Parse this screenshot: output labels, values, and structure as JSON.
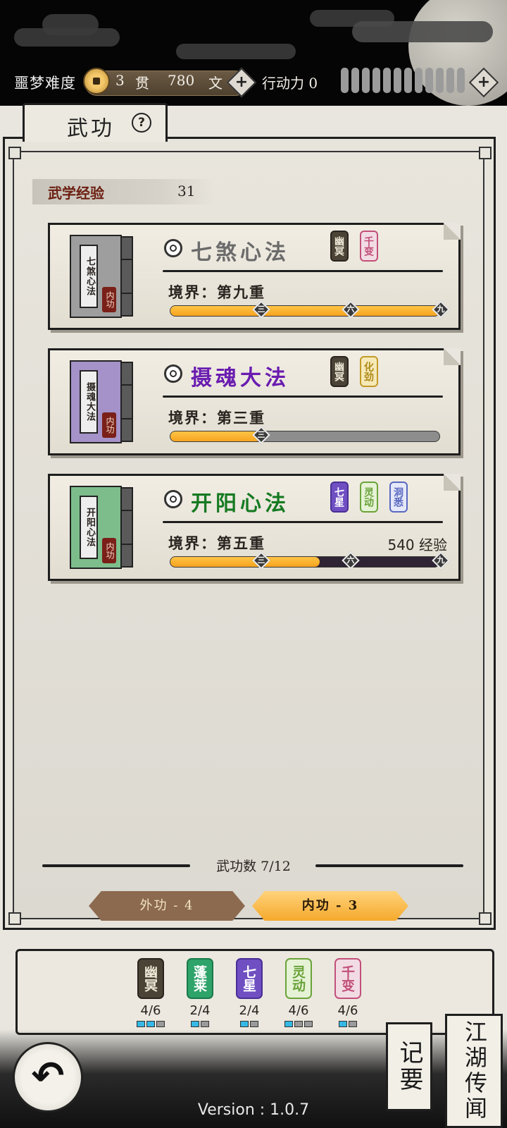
{
  "header": {
    "difficulty_label": "噩梦难度",
    "guan_amount": "3",
    "guan_unit": "贯",
    "wen_amount": "780",
    "wen_unit": "文",
    "action_label": "行动力",
    "action_value": "0",
    "action_pips_filled": 0,
    "action_pips_total": 12
  },
  "panel": {
    "tab_title": "武功",
    "help_symbol": "?",
    "exp_label": "武学经验",
    "exp_value": "31"
  },
  "skills": [
    {
      "name": "七煞心法",
      "name_color": "#6b6b6b",
      "book_color": "#9e9e9e",
      "book_title": "七煞心法",
      "book_seal": "内功",
      "tags": [
        {
          "text": "幽冥",
          "bg": "#4a4336",
          "fg": "#f0ead8",
          "border": "#2a2420"
        },
        {
          "text": "千变",
          "bg": "#f2dce4",
          "fg": "#c2507a",
          "border": "#c2507a"
        }
      ],
      "realm": "境界：第九重",
      "exp_text": "",
      "progress": 1.0,
      "markers": [
        "三",
        "六",
        "九"
      ]
    },
    {
      "name": "摄魂大法",
      "name_color": "#6a1cb0",
      "book_color": "#a592c8",
      "book_title": "摄魂大法",
      "book_seal": "内功",
      "tags": [
        {
          "text": "幽冥",
          "bg": "#4a4336",
          "fg": "#f0ead8",
          "border": "#2a2420"
        },
        {
          "text": "化劲",
          "bg": "#f5e9b8",
          "fg": "#b08a18",
          "border": "#c29a26"
        }
      ],
      "realm": "境界：第三重",
      "exp_text": "",
      "progress": 0.333,
      "markers": [
        "三"
      ]
    },
    {
      "name": "开阳心法",
      "name_color": "#167a22",
      "book_color": "#7dbd8c",
      "book_title": "开阳心法",
      "book_seal": "内功",
      "tags": [
        {
          "text": "七星",
          "bg": "#6f4fc2",
          "fg": "#ffffff",
          "border": "#4a2f96"
        },
        {
          "text": "灵动",
          "bg": "#e6f2d6",
          "fg": "#6aa33a",
          "border": "#6aa33a"
        },
        {
          "text": "洞悉",
          "bg": "#e4e8f8",
          "fg": "#5868c0",
          "border": "#5868c0"
        }
      ],
      "realm": "境界：第五重",
      "exp_text": "540 经验",
      "progress": 0.555,
      "markers": [
        "三",
        "六",
        "九"
      ]
    }
  ],
  "summary": {
    "count_text": "武功数 7/12",
    "tab_waigong": "外功 - 4",
    "tab_neigong": "内功 - 3"
  },
  "sets": [
    {
      "badge": "幽冥",
      "bg": "#4a4336",
      "fg": "#f0ead8",
      "border": "#2a2420",
      "count": "4/6",
      "active": 2,
      "total": 3
    },
    {
      "badge": "蓬莱",
      "bg": "#2ea36a",
      "fg": "#ffffff",
      "border": "#1b7a4a",
      "count": "2/4",
      "active": 1,
      "total": 2
    },
    {
      "badge": "七星",
      "bg": "#6f4fc2",
      "fg": "#ffffff",
      "border": "#4a2f96",
      "count": "2/4",
      "active": 1,
      "total": 2
    },
    {
      "badge": "灵动",
      "bg": "#e6f2d6",
      "fg": "#6aa33a",
      "border": "#6aa33a",
      "count": "4/6",
      "active": 1,
      "total": 3
    },
    {
      "badge": "千变",
      "bg": "#f2dce4",
      "fg": "#c2507a",
      "border": "#c2507a",
      "count": "4/6",
      "active": 1,
      "total": 2
    }
  ],
  "footer": {
    "back_icon": "↶",
    "notes_label": "记要",
    "rumors_label": "江湖传闻",
    "version": "Version : 1.0.7"
  }
}
